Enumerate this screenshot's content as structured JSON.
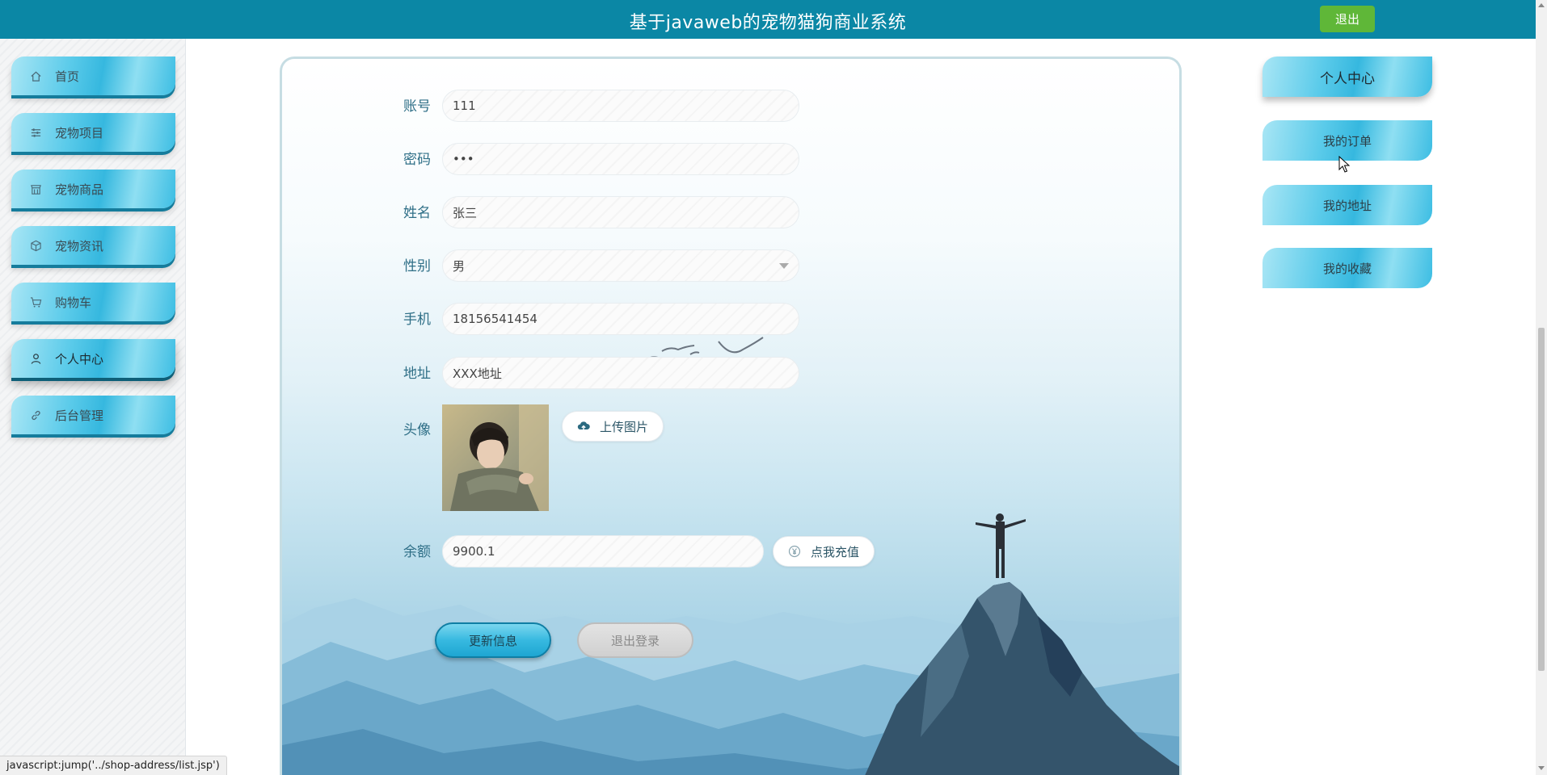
{
  "header": {
    "title": "基于javaweb的宠物猫狗商业系统",
    "logout_label": "退出"
  },
  "sidebar": {
    "items": [
      {
        "label": "首页",
        "icon": "home-icon"
      },
      {
        "label": "宠物项目",
        "icon": "sliders-icon"
      },
      {
        "label": "宠物商品",
        "icon": "shop-icon"
      },
      {
        "label": "宠物资讯",
        "icon": "cube-icon"
      },
      {
        "label": "购物车",
        "icon": "cart-icon"
      },
      {
        "label": "个人中心",
        "icon": "user-icon"
      },
      {
        "label": "后台管理",
        "icon": "link-icon"
      }
    ],
    "active": "个人中心"
  },
  "form": {
    "account": {
      "label": "账号",
      "value": "111"
    },
    "password": {
      "label": "密码",
      "value": "•••"
    },
    "name": {
      "label": "姓名",
      "value": "张三"
    },
    "gender": {
      "label": "性别",
      "value": "男"
    },
    "phone": {
      "label": "手机",
      "value": "18156541454"
    },
    "address": {
      "label": "地址",
      "value": "XXX地址"
    },
    "avatar": {
      "label": "头像",
      "upload_label": "上传图片"
    },
    "balance": {
      "label": "余额",
      "value": "9900.1",
      "recharge_label": "点我充值"
    },
    "update_label": "更新信息",
    "logout_label": "退出登录"
  },
  "right_menu": {
    "items": [
      {
        "label": "个人中心"
      },
      {
        "label": "我的订单"
      },
      {
        "label": "我的地址"
      },
      {
        "label": "我的收藏"
      }
    ]
  },
  "status_bar": {
    "text": "javascript:jump('../shop-address/list.jsp')"
  },
  "colors": {
    "header": "#0b87a5",
    "logout_button": "#5fb738",
    "nav_gradient_mid": "#36b8df",
    "label_text": "#2f6f87"
  }
}
